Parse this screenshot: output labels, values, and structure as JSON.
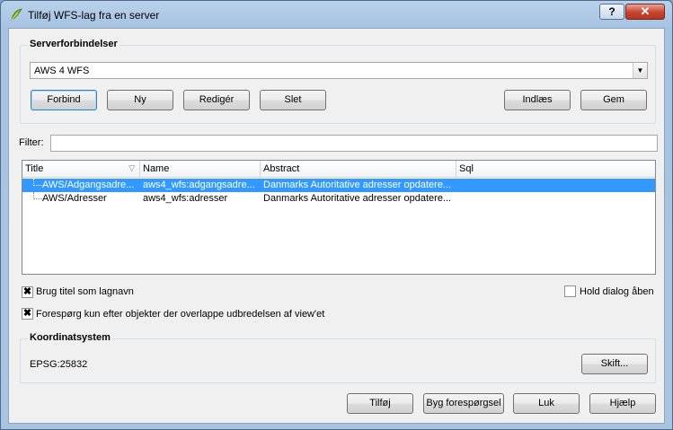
{
  "window": {
    "title": "Tilføj WFS-lag fra en server",
    "help_label": "?",
    "close_label": "✕"
  },
  "server_group": {
    "title": "Serverforbindelser",
    "selected_connection": "AWS 4 WFS",
    "buttons": {
      "connect": "Forbind",
      "new": "Ny",
      "edit": "Redigér",
      "delete": "Slet",
      "load": "Indlæs",
      "save": "Gem"
    }
  },
  "filter": {
    "label": "Filter:",
    "value": ""
  },
  "table": {
    "columns": [
      "Title",
      "Name",
      "Abstract",
      "Sql"
    ],
    "rows": [
      {
        "title": "AWS/Adgangsadre...",
        "name": "aws4_wfs:adgangsadre...",
        "abstract": "Danmarks Autoritative adresser opdatere...",
        "sql": "",
        "selected": true
      },
      {
        "title": "AWS/Adresser",
        "name": "aws4_wfs:adresser",
        "abstract": "Danmarks Autoritative adresser opdatere...",
        "sql": "",
        "selected": false
      }
    ]
  },
  "options": {
    "use_title_checked": true,
    "use_title_label": "Brug titel som lagnavn",
    "keep_open_checked": false,
    "keep_open_label": "Hold dialog åben",
    "bbox_checked": true,
    "bbox_label": "Forespørg kun efter objekter der overlappe udbredelsen af view'et"
  },
  "crs_group": {
    "title": "Koordinatsystem",
    "value": "EPSG:25832",
    "change_label": "Skift..."
  },
  "footer": {
    "add": "Tilføj",
    "build_query": "Byg forespørgsel",
    "close": "Luk",
    "help": "Hjælp"
  }
}
